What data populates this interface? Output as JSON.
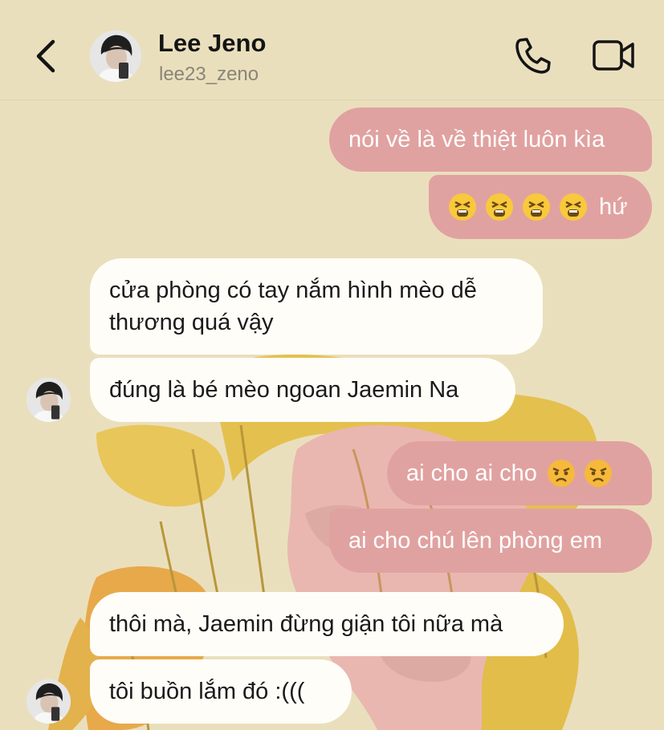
{
  "header": {
    "name": "Lee Jeno",
    "username": "lee23_zeno"
  },
  "colors": {
    "background": "#eadfbd",
    "outgoing_bubble": "#e0a2a0",
    "incoming_bubble": "#fffdf8",
    "text_dark": "#1a1a1a",
    "text_muted": "#8b8577"
  },
  "icons": {
    "back": "chevron-left-icon",
    "call": "phone-icon",
    "video": "video-camera-icon"
  },
  "messages": [
    {
      "direction": "outgoing",
      "text": "nói về là về thiệt luôn kìa"
    },
    {
      "direction": "outgoing",
      "emojis": [
        "tired-face",
        "tired-face",
        "tired-face",
        "tired-face"
      ],
      "text": "hứ"
    },
    {
      "direction": "incoming",
      "line1": "cửa phòng có tay nắm hình mèo dễ",
      "line2": "thương quá vậy"
    },
    {
      "direction": "incoming",
      "text": "đúng là bé mèo ngoan Jaemin Na"
    },
    {
      "direction": "outgoing",
      "text": "ai cho ai cho",
      "emojis": [
        "angry-face",
        "angry-face"
      ]
    },
    {
      "direction": "outgoing",
      "text": "ai cho chú lên phòng em"
    },
    {
      "direction": "incoming",
      "text": "thôi mà, Jaemin đừng giận tôi nữa mà"
    },
    {
      "direction": "incoming",
      "text": "tôi buồn lắm đó :((("
    }
  ]
}
